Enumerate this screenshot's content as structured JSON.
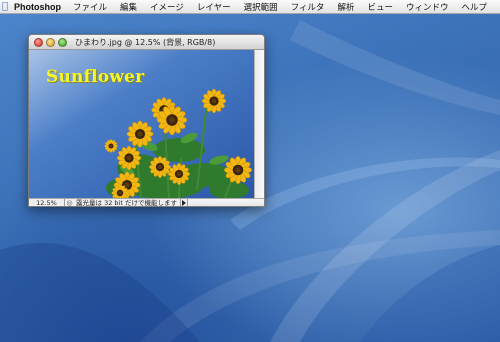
{
  "menubar": {
    "apple_icon": "apple-icon",
    "app_name": "Photoshop",
    "items": [
      "ファイル",
      "編集",
      "イメージ",
      "レイヤー",
      "選択範囲",
      "フィルタ",
      "解析",
      "ビュー",
      "ウィンドウ",
      "ヘルプ"
    ]
  },
  "window": {
    "title": "ひまわり.jpg @ 12.5% (背景, RGB/8)",
    "photo_text": "Sunflower",
    "zoom": "12.5%",
    "status": "露光量は 32 bit だけで機能します"
  },
  "colors": {
    "desktop": "#3f73b8",
    "sky_top": "#2f5fb4",
    "sky_bottom": "#a9c3e6",
    "photo_text": "#f5f52a",
    "petal": "#f2b713",
    "leaf": "#2f7a2c"
  }
}
